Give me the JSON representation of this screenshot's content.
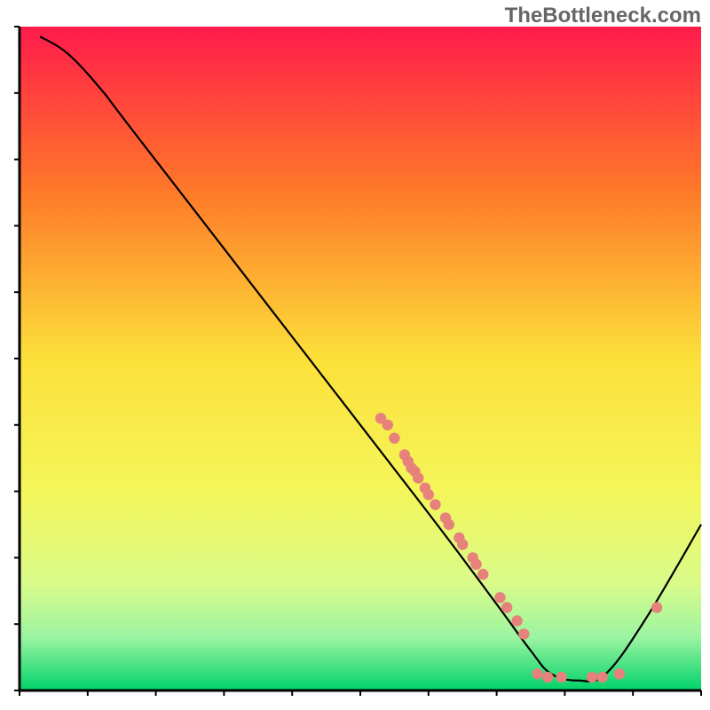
{
  "watermark": "TheBottleneck.com",
  "colors": {
    "curve": "#000000",
    "dots": "#E6817B",
    "axis": "#000000"
  },
  "chart_data": {
    "type": "line",
    "title": "",
    "xlabel": "",
    "ylabel": "",
    "xlim": [
      0,
      100
    ],
    "ylim": [
      0,
      100
    ],
    "note": "Axes have no visible tick labels; x/y are normalized 0–100 in plot-area coordinates (origin bottom-left). Background is a vertical red→green gradient. Curve is a bottleneck curve with scattered data markers.",
    "background_gradient": [
      {
        "stop": 0.0,
        "color": "#FF1B4B"
      },
      {
        "stop": 0.25,
        "color": "#FF7A29"
      },
      {
        "stop": 0.5,
        "color": "#FCE03A"
      },
      {
        "stop": 0.7,
        "color": "#F4F65A"
      },
      {
        "stop": 0.84,
        "color": "#D9FB8A"
      },
      {
        "stop": 0.92,
        "color": "#9BF4A1"
      },
      {
        "stop": 1.0,
        "color": "#00D26A"
      }
    ],
    "series": [
      {
        "name": "bottleneck_curve",
        "type": "line",
        "points": [
          {
            "x": 3.0,
            "y": 98.5
          },
          {
            "x": 7.0,
            "y": 96.0
          },
          {
            "x": 12.0,
            "y": 90.5
          },
          {
            "x": 18.0,
            "y": 82.5
          },
          {
            "x": 50.0,
            "y": 40.0
          },
          {
            "x": 62.0,
            "y": 24.0
          },
          {
            "x": 70.0,
            "y": 13.0
          },
          {
            "x": 75.0,
            "y": 6.0
          },
          {
            "x": 78.0,
            "y": 2.5
          },
          {
            "x": 82.0,
            "y": 1.5
          },
          {
            "x": 86.0,
            "y": 2.5
          },
          {
            "x": 92.0,
            "y": 11.0
          },
          {
            "x": 100.0,
            "y": 25.0
          }
        ]
      },
      {
        "name": "data_points",
        "type": "scatter",
        "points": [
          {
            "x": 53.0,
            "y": 41.0
          },
          {
            "x": 54.0,
            "y": 40.0
          },
          {
            "x": 55.0,
            "y": 38.0
          },
          {
            "x": 56.5,
            "y": 35.5
          },
          {
            "x": 57.0,
            "y": 34.5
          },
          {
            "x": 57.5,
            "y": 33.5
          },
          {
            "x": 58.0,
            "y": 33.0
          },
          {
            "x": 58.5,
            "y": 32.0
          },
          {
            "x": 59.5,
            "y": 30.5
          },
          {
            "x": 60.0,
            "y": 29.5
          },
          {
            "x": 61.0,
            "y": 28.0
          },
          {
            "x": 62.5,
            "y": 26.0
          },
          {
            "x": 63.0,
            "y": 25.0
          },
          {
            "x": 64.5,
            "y": 23.0
          },
          {
            "x": 65.0,
            "y": 22.0
          },
          {
            "x": 66.5,
            "y": 20.0
          },
          {
            "x": 67.0,
            "y": 19.0
          },
          {
            "x": 68.0,
            "y": 17.5
          },
          {
            "x": 70.5,
            "y": 14.0
          },
          {
            "x": 71.5,
            "y": 12.5
          },
          {
            "x": 73.0,
            "y": 10.5
          },
          {
            "x": 74.0,
            "y": 8.5
          },
          {
            "x": 76.0,
            "y": 2.5
          },
          {
            "x": 77.5,
            "y": 2.0
          },
          {
            "x": 79.5,
            "y": 2.0
          },
          {
            "x": 84.0,
            "y": 2.0
          },
          {
            "x": 85.5,
            "y": 2.0
          },
          {
            "x": 88.0,
            "y": 2.5
          },
          {
            "x": 93.5,
            "y": 12.5
          }
        ]
      }
    ]
  }
}
